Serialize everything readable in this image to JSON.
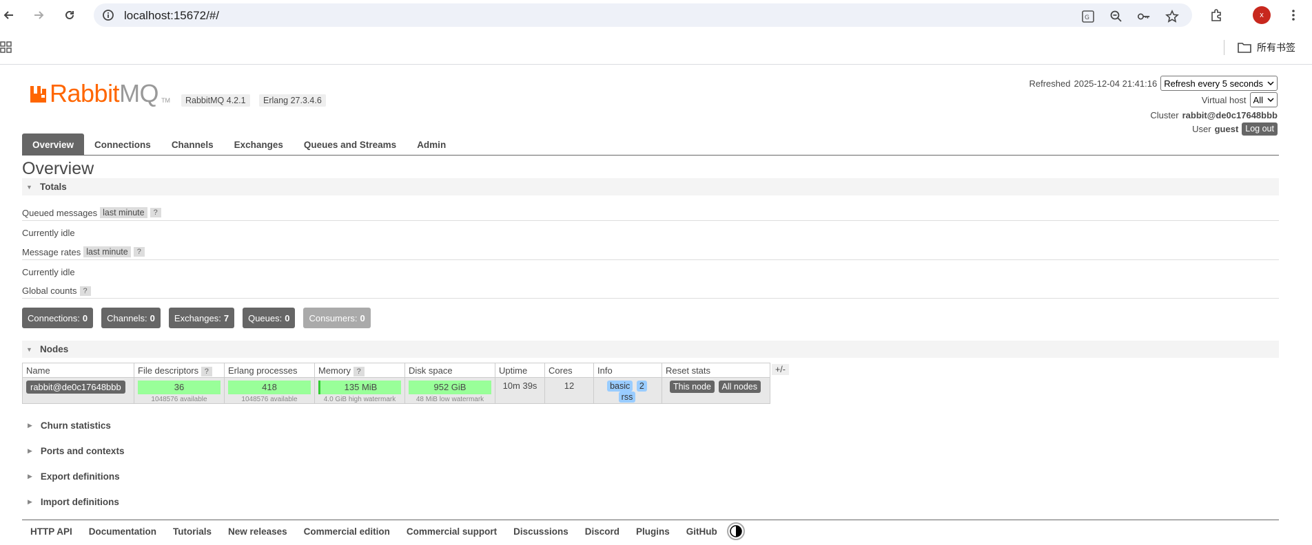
{
  "browser": {
    "url": "localhost:15672/#/",
    "avatar_letter": "x",
    "bookmarks_folder": "所有书签"
  },
  "brand": {
    "name_part1": "Rabbit",
    "name_part2": "MQ",
    "tm": "TM",
    "version": "RabbitMQ 4.2.1",
    "erlang": "Erlang 27.3.4.6"
  },
  "header": {
    "refreshed_label": "Refreshed",
    "refreshed_time": "2025-12-04 21:41:16",
    "refresh_select": "Refresh every 5 seconds",
    "vhost_label": "Virtual host",
    "vhost_value": "All",
    "cluster_label": "Cluster",
    "cluster_value": "rabbit@de0c17648bbb",
    "user_label": "User",
    "user_value": "guest",
    "logout": "Log out"
  },
  "tabs": [
    "Overview",
    "Connections",
    "Channels",
    "Exchanges",
    "Queues and Streams",
    "Admin"
  ],
  "page_title": "Overview",
  "totals": {
    "heading": "Totals",
    "queued_label": "Queued messages",
    "queued_range": "last minute",
    "help": "?",
    "idle1": "Currently idle",
    "rates_label": "Message rates",
    "rates_range": "last minute",
    "idle2": "Currently idle",
    "global_label": "Global counts",
    "counts": [
      {
        "label": "Connections:",
        "value": "0"
      },
      {
        "label": "Channels:",
        "value": "0"
      },
      {
        "label": "Exchanges:",
        "value": "7"
      },
      {
        "label": "Queues:",
        "value": "0"
      },
      {
        "label": "Consumers:",
        "value": "0"
      }
    ]
  },
  "nodes": {
    "heading": "Nodes",
    "columns": [
      "Name",
      "File descriptors",
      "Erlang processes",
      "Memory",
      "Disk space",
      "Uptime",
      "Cores",
      "Info",
      "Reset stats"
    ],
    "plusminus": "+/-",
    "row": {
      "name": "rabbit@de0c17648bbb",
      "fd": "36",
      "fd_sub": "1048576 available",
      "procs": "418",
      "procs_sub": "1048576 available",
      "memory": "135 MiB",
      "memory_sub": "4.0 GiB high watermark",
      "disk": "952 GiB",
      "disk_sub": "48 MiB low watermark",
      "uptime": "10m 39s",
      "cores": "12",
      "info_tags": [
        "basic",
        "2",
        "rss"
      ],
      "reset_this": "This node",
      "reset_all": "All nodes"
    }
  },
  "collapsed_sections": [
    "Churn statistics",
    "Ports and contexts",
    "Export definitions",
    "Import definitions"
  ],
  "footer": [
    "HTTP API",
    "Documentation",
    "Tutorials",
    "New releases",
    "Commercial edition",
    "Commercial support",
    "Discussions",
    "Discord",
    "Plugins",
    "GitHub"
  ]
}
